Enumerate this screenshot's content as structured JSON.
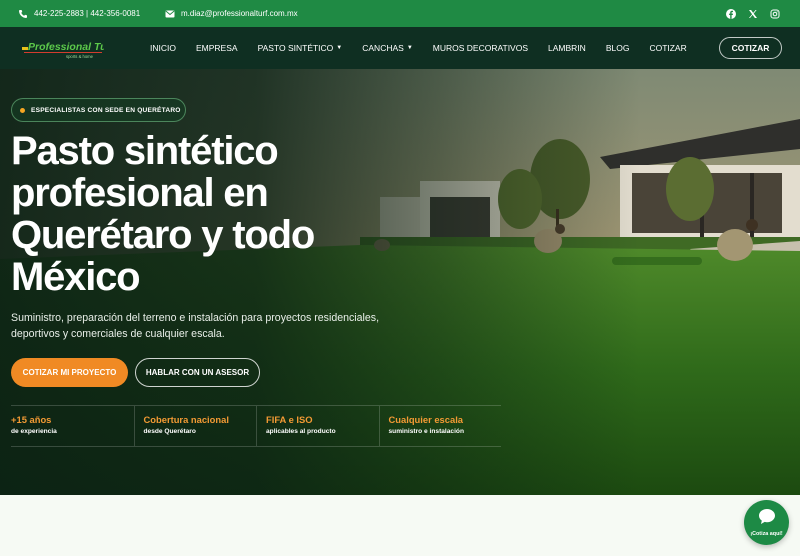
{
  "topbar": {
    "phone": "442-225-2883 | 442-356-0081",
    "email": "m.diaz@professionalturf.com.mx",
    "social_icons": [
      "facebook-icon",
      "x-icon",
      "instagram-icon"
    ]
  },
  "nav": {
    "logo_text": "Professional Turf",
    "logo_tagline": "sports & home",
    "items": [
      {
        "label": "INICIO",
        "dropdown": false
      },
      {
        "label": "EMPRESA",
        "dropdown": false
      },
      {
        "label": "PASTO SINTÉTICO",
        "dropdown": true
      },
      {
        "label": "CANCHAS",
        "dropdown": true
      },
      {
        "label": "MUROS DECORATIVOS",
        "dropdown": false
      },
      {
        "label": "LAMBRIN",
        "dropdown": false
      },
      {
        "label": "BLOG",
        "dropdown": false
      },
      {
        "label": "COTIZAR",
        "dropdown": false
      }
    ],
    "cta_label": "COTIZAR"
  },
  "hero": {
    "badge": "ESPECIALISTAS CON SEDE EN QUERÉTARO",
    "title_lines": [
      "Pasto sintético",
      "profesional en",
      "Querétaro y todo",
      "México"
    ],
    "subtitle": "Suministro, preparación del terreno e instalación para proyectos residenciales, deportivos y comerciales de cualquier escala.",
    "primary_button": "COTIZAR MI PROYECTO",
    "secondary_button": "HABLAR CON UN ASESOR",
    "stats": [
      {
        "value": "+15 años",
        "label": "de experiencia"
      },
      {
        "value": "Cobertura nacional",
        "label": "desde Querétaro"
      },
      {
        "value": "FIFA e ISO",
        "label": "aplicables al producto"
      },
      {
        "value": "Cualquier escala",
        "label": "suministro e instalación"
      }
    ]
  },
  "chat": {
    "label": "¡Cotiza aquí!",
    "icon": "chat-bubble-icon"
  },
  "colors": {
    "topbar": "#1f8a44",
    "nav": "#0f2f22",
    "accent": "#f08a24",
    "stat_value": "#f39a34"
  }
}
